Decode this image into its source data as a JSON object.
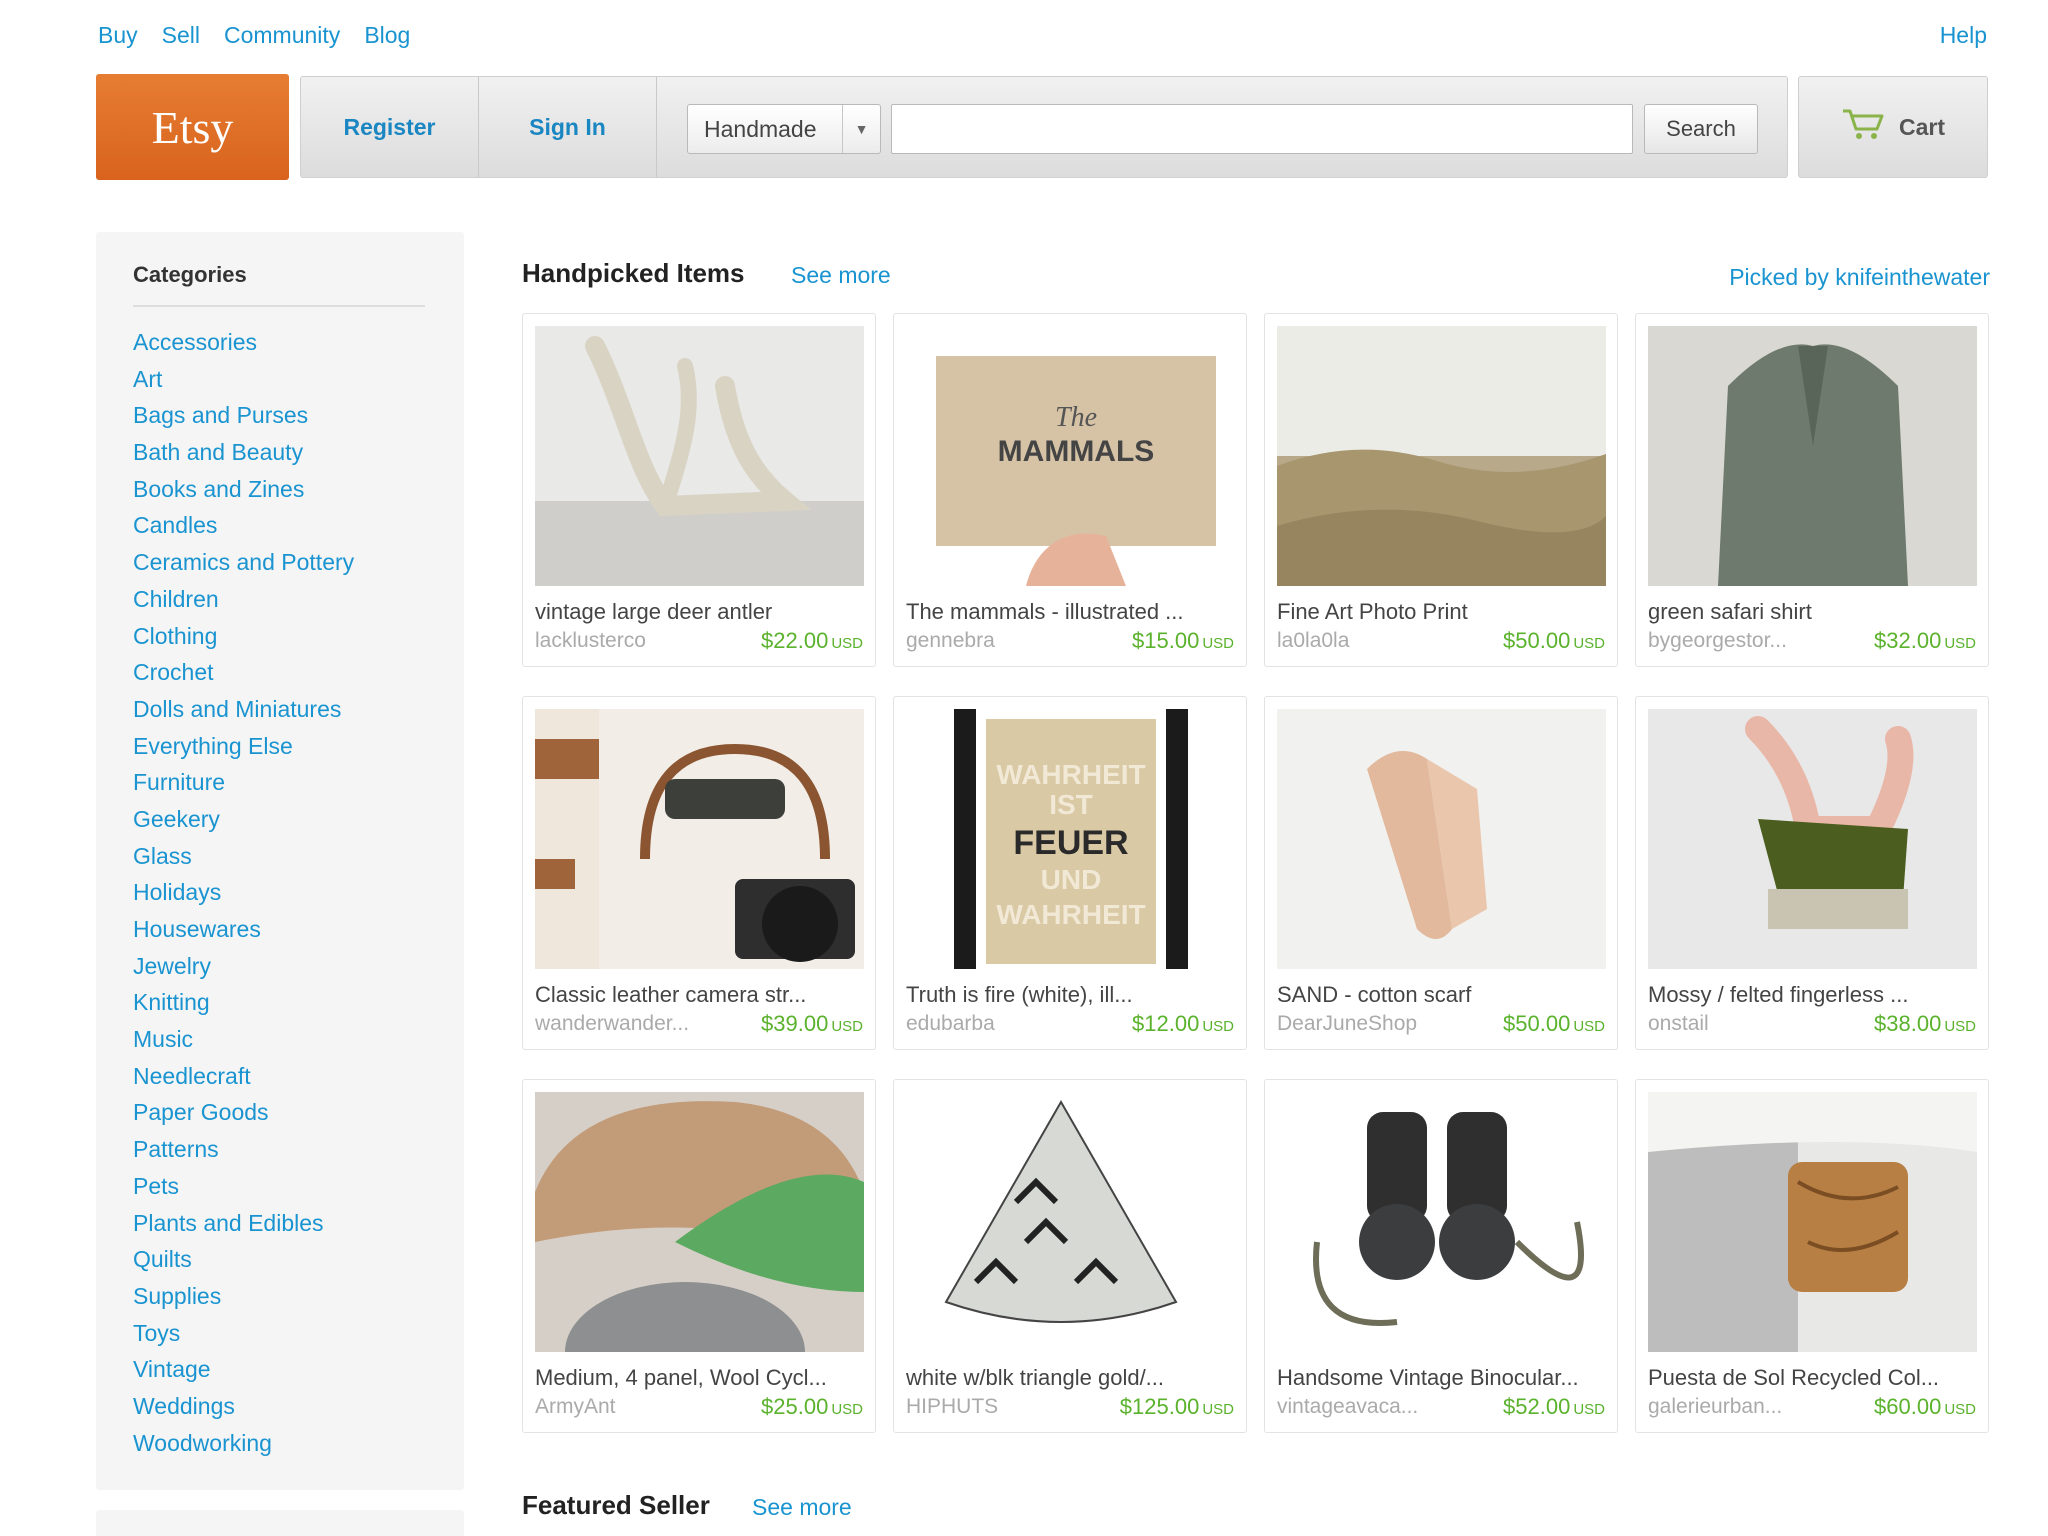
{
  "topnav": {
    "links": [
      "Buy",
      "Sell",
      "Community",
      "Blog"
    ],
    "help": "Help"
  },
  "header": {
    "logo": "Etsy",
    "register": "Register",
    "sign_in": "Sign In",
    "category_select": "Handmade",
    "search_value": "",
    "search_button": "Search",
    "cart": "Cart"
  },
  "sidebar": {
    "title": "Categories",
    "categories": [
      "Accessories",
      "Art",
      "Bags and Purses",
      "Bath and Beauty",
      "Books and Zines",
      "Candles",
      "Ceramics and Pottery",
      "Children",
      "Clothing",
      "Crochet",
      "Dolls and Miniatures",
      "Everything Else",
      "Furniture",
      "Geekery",
      "Glass",
      "Holidays",
      "Housewares",
      "Jewelry",
      "Knitting",
      "Music",
      "Needlecraft",
      "Paper Goods",
      "Patterns",
      "Pets",
      "Plants and Edibles",
      "Quilts",
      "Supplies",
      "Toys",
      "Vintage",
      "Weddings",
      "Woodworking"
    ]
  },
  "handpicked": {
    "title": "Handpicked Items",
    "see_more": "See more",
    "picked_by": "Picked by knifeinthewater",
    "currency": "USD",
    "items": [
      {
        "title": "vintage large deer antler",
        "shop": "lacklusterco",
        "price": "$22.00",
        "icon": "antler-image"
      },
      {
        "title": "The mammals - illustrated ...",
        "shop": "gennebra",
        "price": "$15.00",
        "icon": "book-image",
        "cover_line1": "The",
        "cover_line2": "MAMMALS"
      },
      {
        "title": "Fine Art Photo Print",
        "shop": "la0la0la",
        "price": "$50.00",
        "icon": "dunes-image"
      },
      {
        "title": "green safari shirt",
        "shop": "bygeorgestor...",
        "price": "$32.00",
        "icon": "shirt-image"
      },
      {
        "title": "Classic leather camera str...",
        "shop": "wanderwander...",
        "price": "$39.00",
        "icon": "camera-strap-image"
      },
      {
        "title": "Truth is fire (white), ill...",
        "shop": "edubarba",
        "price": "$12.00",
        "icon": "poster-image",
        "poster_lines": [
          "WAHRHEIT",
          "IST",
          "FEUER",
          "UND",
          "WAHRHEIT"
        ]
      },
      {
        "title": "SAND - cotton scarf",
        "shop": "DearJuneShop",
        "price": "$50.00",
        "icon": "scarf-image"
      },
      {
        "title": "Mossy / felted fingerless ...",
        "shop": "onstail",
        "price": "$38.00",
        "icon": "glove-image"
      },
      {
        "title": "Medium, 4 panel, Wool Cycl...",
        "shop": "ArmyAnt",
        "price": "$25.00",
        "icon": "cap-image"
      },
      {
        "title": "white w/blk triangle gold/...",
        "shop": "HIPHUTS",
        "price": "$125.00",
        "icon": "teepee-image"
      },
      {
        "title": "Handsome Vintage Binocular...",
        "shop": "vintageavaca...",
        "price": "$52.00",
        "icon": "binoculars-image"
      },
      {
        "title": "Puesta de Sol Recycled Col...",
        "shop": "galerieurban...",
        "price": "$60.00",
        "icon": "cuff-image"
      }
    ]
  },
  "featured": {
    "title": "Featured Seller",
    "see_more": "See more"
  }
}
